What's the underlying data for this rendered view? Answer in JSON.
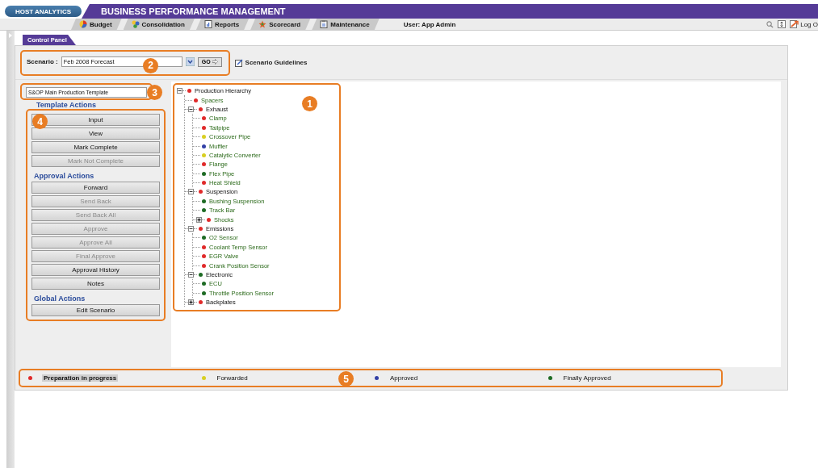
{
  "header": {
    "logo": "HOST ANALYTICS",
    "title": "BUSINESS PERFORMANCE MANAGEMENT"
  },
  "nav": {
    "tabs": [
      {
        "label": "Budget",
        "kind": "pie"
      },
      {
        "label": "Consolidation",
        "kind": "cycle"
      },
      {
        "label": "Reports",
        "kind": "report"
      },
      {
        "label": "Scorecard",
        "kind": "score"
      },
      {
        "label": "Maintenance",
        "kind": "maint"
      }
    ],
    "user": "User: App Admin",
    "logout": "Log O"
  },
  "panel_tab": "Control Panel",
  "scenario": {
    "label": "Scenario :",
    "value": "Feb 2008 Forecast",
    "go": "GO",
    "guidelines": "Scenario Guidelines",
    "callout": "2"
  },
  "template": {
    "value": "S&OP Main Production Template",
    "callout": "3"
  },
  "actions": {
    "callout": "4",
    "groups": [
      {
        "title": "Template Actions",
        "buttons": [
          {
            "label": "Input",
            "disabled": false
          },
          {
            "label": "View",
            "disabled": false
          },
          {
            "label": "Mark Complete",
            "disabled": false
          },
          {
            "label": "Mark Not Complete",
            "disabled": true
          }
        ]
      },
      {
        "title": "Approval Actions",
        "buttons": [
          {
            "label": "Forward",
            "disabled": false
          },
          {
            "label": "Send Back",
            "disabled": true
          },
          {
            "label": "Send Back All",
            "disabled": true
          },
          {
            "label": "Approve",
            "disabled": true
          },
          {
            "label": "Approve All",
            "disabled": true
          },
          {
            "label": "Final Approve",
            "disabled": true
          },
          {
            "label": "Approval History",
            "disabled": false
          },
          {
            "label": "Notes",
            "disabled": false
          }
        ]
      },
      {
        "title": "Global Actions",
        "buttons": [
          {
            "label": "Edit Scenario",
            "disabled": false
          }
        ]
      }
    ]
  },
  "tree": {
    "callout": "1",
    "nodes": [
      {
        "label": "Production Hierarchy",
        "color": "#e02a2a",
        "expanded": true,
        "children": [
          {
            "label": "Spacers",
            "color": "#e02a2a"
          },
          {
            "label": "Exhaust",
            "color": "#e02a2a",
            "expanded": true,
            "children": [
              {
                "label": "Clamp",
                "color": "#e02a2a"
              },
              {
                "label": "Tailpipe",
                "color": "#e02a2a"
              },
              {
                "label": "Crossover Pipe",
                "color": "#d8cf22"
              },
              {
                "label": "Muffler",
                "color": "#3341a6"
              },
              {
                "label": "Catalytic Converter",
                "color": "#d8cf22"
              },
              {
                "label": "Flange",
                "color": "#e02a2a"
              },
              {
                "label": "Flex Pipe",
                "color": "#1e6b24"
              },
              {
                "label": "Heat Shield",
                "color": "#e02a2a"
              }
            ]
          },
          {
            "label": "Suspension",
            "color": "#e02a2a",
            "expanded": true,
            "children": [
              {
                "label": "Bushing Suspension",
                "color": "#1e6b24"
              },
              {
                "label": "Track Bar",
                "color": "#1e6b24"
              },
              {
                "label": "Shocks",
                "color": "#e02a2a",
                "expanded": false
              }
            ]
          },
          {
            "label": "Emissions",
            "color": "#e02a2a",
            "expanded": true,
            "children": [
              {
                "label": "O2 Sensor",
                "color": "#1e6b24"
              },
              {
                "label": "Coolant Temp Sensor",
                "color": "#e02a2a"
              },
              {
                "label": "EGR Valve",
                "color": "#e02a2a"
              },
              {
                "label": "Crank Position Sensor",
                "color": "#e02a2a"
              }
            ]
          },
          {
            "label": "Electronic",
            "color": "#1e6b24",
            "expanded": true,
            "children": [
              {
                "label": "ECU",
                "color": "#1e6b24"
              },
              {
                "label": "Throttle Position Sensor",
                "color": "#1e6b24"
              }
            ]
          },
          {
            "label": "Backplates",
            "color": "#e02a2a",
            "expanded": false
          }
        ]
      }
    ]
  },
  "legend": {
    "callout": "5",
    "items": [
      {
        "label": "Preparation in progress",
        "color": "#e02a2a",
        "selected": true
      },
      {
        "label": "Forwarded",
        "color": "#d8cf22",
        "selected": false
      },
      {
        "label": "Approved",
        "color": "#3341a6",
        "selected": false
      },
      {
        "label": "Finally Approved",
        "color": "#1e6b24",
        "selected": false
      }
    ]
  }
}
